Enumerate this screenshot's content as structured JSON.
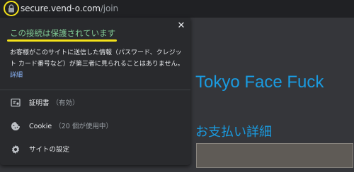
{
  "address_bar": {
    "host": "secure.vend-o.com",
    "path": "/join",
    "lock_icon": "lock-icon",
    "highlight_color": "#f4e21a"
  },
  "page": {
    "title": "Tokyo Face Fuck",
    "subtitle": "お支払い詳細",
    "accent_color": "#1a9be0"
  },
  "site_info_popup": {
    "title": "この接続は保護されています",
    "title_color": "#81c995",
    "description": "お客様がこのサイトに送信した情報（パスワード、クレジット カード番号など）が第三者に見られることはありません。",
    "details_link": "詳細",
    "close_icon": "close-icon",
    "items": [
      {
        "label": "証明書",
        "sub": "（有効）",
        "icon": "certificate-icon"
      },
      {
        "label": "Cookie",
        "sub": "（20 個が使用中）",
        "icon": "cookie-icon"
      },
      {
        "label": "サイトの設定",
        "sub": "",
        "icon": "gear-icon"
      }
    ]
  }
}
